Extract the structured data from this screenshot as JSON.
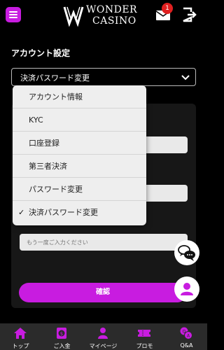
{
  "header": {
    "logo_line1": "WONDER",
    "logo_line2": "CASINO",
    "mail_badge_count": "1"
  },
  "section": {
    "title": "アカウント設定",
    "select_value": "決済パスワード変更"
  },
  "dropdown": {
    "items": [
      {
        "label": "アカウント情報",
        "selected": false
      },
      {
        "label": "KYC",
        "selected": false
      },
      {
        "label": "口座登録",
        "selected": false
      },
      {
        "label": "第三者決済",
        "selected": false
      },
      {
        "label": "パスワード変更",
        "selected": false
      },
      {
        "label": "決済パスワード変更",
        "selected": true
      }
    ],
    "check_mark": "✓"
  },
  "form": {
    "confirm_placeholder": "もう一度ご入力ください",
    "submit_label": "確認"
  },
  "bottom_nav": {
    "items": [
      {
        "label": "トップ",
        "icon": "home-icon"
      },
      {
        "label": "ご入金",
        "icon": "deposit-icon"
      },
      {
        "label": "マイページ",
        "icon": "mypage-icon"
      },
      {
        "label": "プロモ",
        "icon": "promo-icon"
      },
      {
        "label": "Q&A",
        "icon": "qa-icon"
      }
    ]
  },
  "colors": {
    "accent": "#c81ce0",
    "background": "#000000",
    "badge": "#e02020",
    "dropdown_bg": "#eeeeee",
    "nav_bg": "#2b2b2b"
  }
}
